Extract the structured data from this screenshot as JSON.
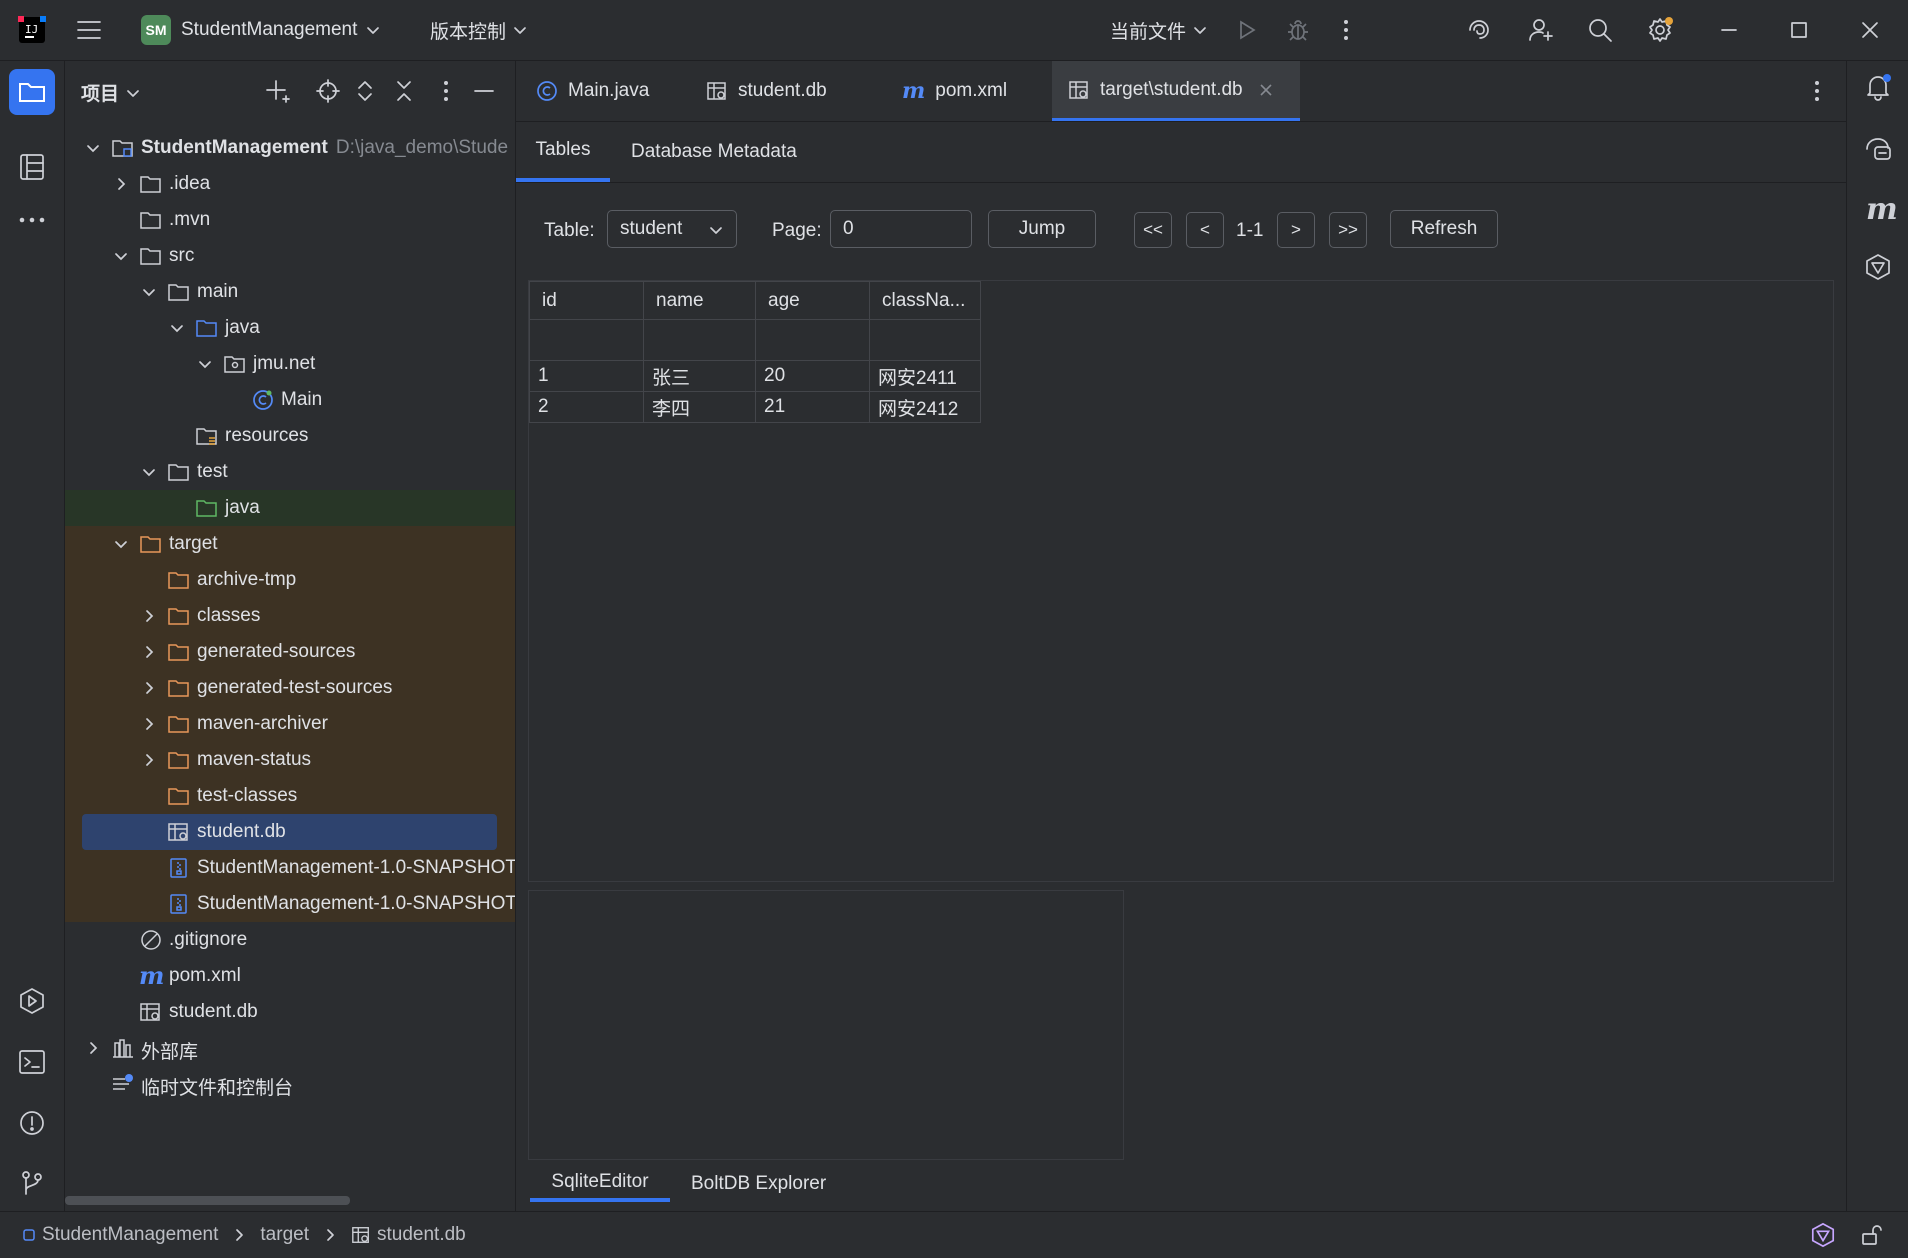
{
  "titlebar": {
    "project_badge": "SM",
    "project_name": "StudentManagement",
    "vcs_label": "版本控制",
    "run_config": "当前文件"
  },
  "project_panel": {
    "title": "项目",
    "tree": [
      {
        "label": "StudentManagement",
        "path": "D:\\java_demo\\Stude",
        "icon": "module-folder-icon",
        "expanded": true
      },
      {
        "label": ".idea",
        "icon": "folder-icon",
        "expanded": false
      },
      {
        "label": ".mvn",
        "icon": "folder-icon"
      },
      {
        "label": "src",
        "icon": "folder-icon",
        "expanded": true
      },
      {
        "label": "main",
        "icon": "folder-icon",
        "expanded": true
      },
      {
        "label": "java",
        "icon": "source-folder-icon",
        "expanded": true
      },
      {
        "label": "jmu.net",
        "icon": "package-icon",
        "expanded": true
      },
      {
        "label": "Main",
        "icon": "class-icon"
      },
      {
        "label": "resources",
        "icon": "resources-folder-icon"
      },
      {
        "label": "test",
        "icon": "folder-icon",
        "expanded": true
      },
      {
        "label": "java",
        "icon": "test-folder-icon"
      },
      {
        "label": "target",
        "icon": "excluded-folder-icon",
        "expanded": true
      },
      {
        "label": "archive-tmp",
        "icon": "excluded-folder-icon"
      },
      {
        "label": "classes",
        "icon": "excluded-folder-icon",
        "expanded": false
      },
      {
        "label": "generated-sources",
        "icon": "excluded-folder-icon",
        "expanded": false
      },
      {
        "label": "generated-test-sources",
        "icon": "excluded-folder-icon",
        "expanded": false
      },
      {
        "label": "maven-archiver",
        "icon": "excluded-folder-icon",
        "expanded": false
      },
      {
        "label": "maven-status",
        "icon": "excluded-folder-icon",
        "expanded": false
      },
      {
        "label": "test-classes",
        "icon": "excluded-folder-icon"
      },
      {
        "label": "student.db",
        "icon": "database-file-icon",
        "selected": true
      },
      {
        "label": "StudentManagement-1.0-SNAPSHOT",
        "icon": "archive-icon"
      },
      {
        "label": "StudentManagement-1.0-SNAPSHOT",
        "icon": "archive-icon"
      },
      {
        "label": ".gitignore",
        "icon": "ignore-file-icon"
      },
      {
        "label": "pom.xml",
        "icon": "maven-icon"
      },
      {
        "label": "student.db",
        "icon": "database-file-icon"
      },
      {
        "label": "外部库",
        "icon": "library-icon",
        "expanded": false
      },
      {
        "label": "临时文件和控制台",
        "icon": "scratches-icon"
      }
    ]
  },
  "editor_tabs": [
    {
      "label": "Main.java",
      "icon": "class-icon"
    },
    {
      "label": "student.db",
      "icon": "database-file-icon"
    },
    {
      "label": "pom.xml",
      "icon": "maven-icon"
    },
    {
      "label": "target\\student.db",
      "icon": "database-file-icon",
      "active": true
    }
  ],
  "db_view": {
    "subtabs": [
      "Tables",
      "Database Metadata"
    ],
    "table_label": "Table:",
    "table_value": "student",
    "page_label": "Page:",
    "page_value": "0",
    "jump": "Jump",
    "first": "<<",
    "prev": "<",
    "range": "1-1",
    "next": ">",
    "last": ">>",
    "refresh": "Refresh",
    "columns": [
      "id",
      "name",
      "age",
      "classNa..."
    ],
    "rows": [
      [
        "",
        "",
        "",
        ""
      ],
      [
        "1",
        "张三",
        "20",
        "网安2411"
      ],
      [
        "2",
        "李四",
        "21",
        "网安2412"
      ]
    ],
    "bottom_tabs": [
      "SqliteEditor",
      "BoltDB Explorer"
    ]
  },
  "statusbar": {
    "breadcrumbs": [
      "StudentManagement",
      "target",
      "student.db"
    ]
  },
  "colors": {
    "accent": "#3574f0",
    "excluded_bg": "#3d3223",
    "test_bg": "#283627",
    "selected_bg": "#2e436e",
    "folder_orange": "#e8975a",
    "folder_green": "#5fb865",
    "folder_blue": "#548af7"
  }
}
